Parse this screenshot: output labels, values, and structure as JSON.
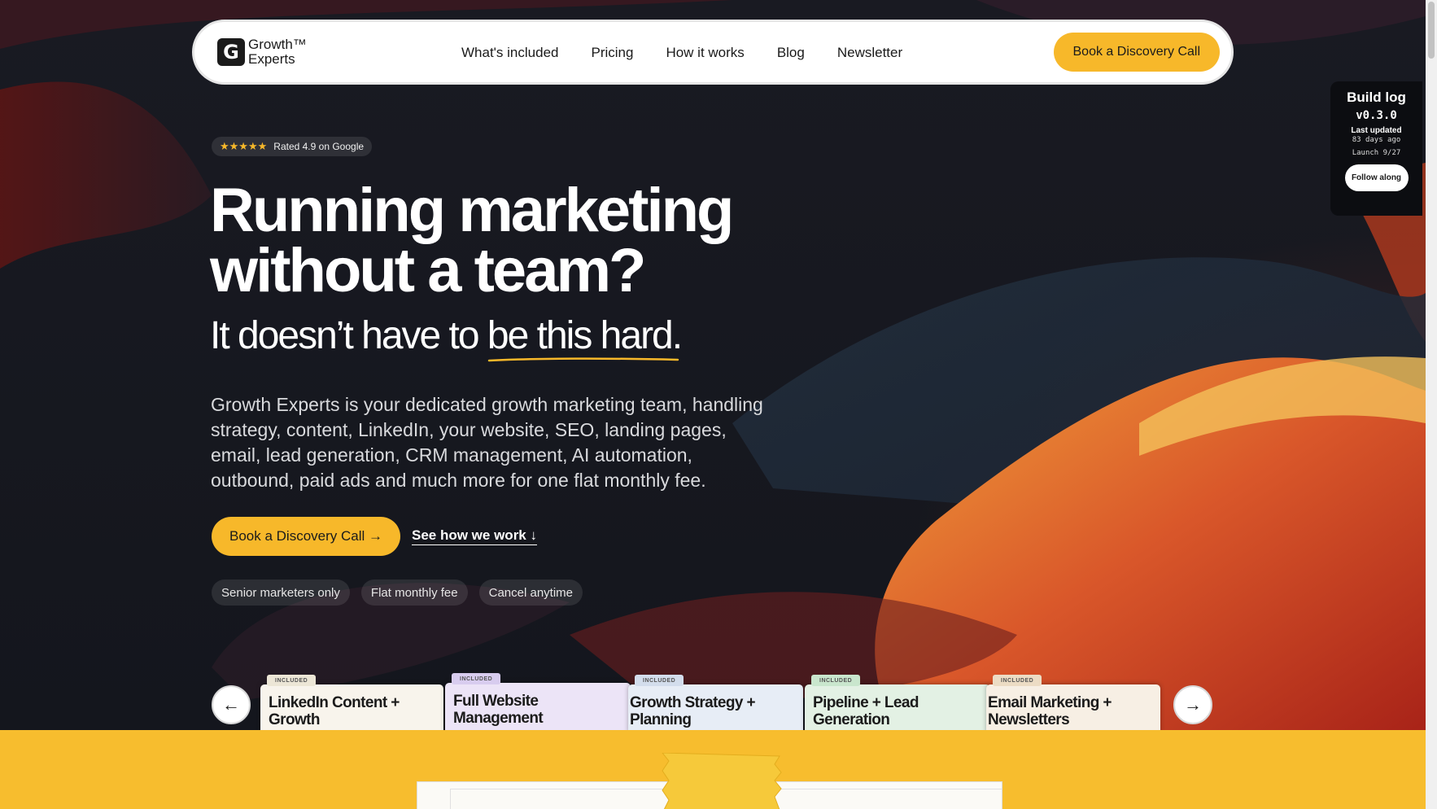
{
  "nav": {
    "logo_line1": "Growth™",
    "logo_line2": "Experts",
    "links": [
      "What's included",
      "Pricing",
      "How it works",
      "Blog",
      "Newsletter"
    ],
    "cta": "Book a Discovery Call"
  },
  "build_log": {
    "title": "Build log",
    "version": "v0.3.0",
    "updated_label": "Last updated",
    "updated_ago": "83 days ago",
    "launch": "Launch 9/27",
    "follow": "Follow along"
  },
  "hero": {
    "rating_stars": "★★★★★",
    "rating_text": "Rated 4.9 on Google",
    "headline": "Running marketing without a team?",
    "subhead_plain": "It doesn’t have to ",
    "subhead_underlined": "be this hard",
    "subhead_end": ".",
    "description": "Growth Experts is your dedicated growth marketing team, handling strategy, content, LinkedIn, your website, SEO, landing pages, email, lead generation, CRM management, AI automation, outbound, paid ads and much more for one flat monthly fee.",
    "cta_primary": "Book a Discovery Call →",
    "cta_secondary": "See how we work ↓",
    "chips": [
      "Senior marketers only",
      "Flat monthly fee",
      "Cancel anytime"
    ]
  },
  "carousel": {
    "prev_icon": "←",
    "next_icon": "→",
    "cards": [
      {
        "tag": "INCLUDED",
        "title_line1": "LinkedIn Content +",
        "title_line2": "Growth",
        "color": "#f8f4ec",
        "tag_color": "#ece6d6"
      },
      {
        "tag": "INCLUDED",
        "title_line1": "Full Website",
        "title_line2": "Management",
        "color": "#ece4f7",
        "tag_color": "#d8ccef"
      },
      {
        "tag": "INCLUDED",
        "title_line1": "Growth Strategy +",
        "title_line2": "Planning",
        "color": "#e7edf6",
        "tag_color": "#d3ddec"
      },
      {
        "tag": "INCLUDED",
        "title_line1": "Pipeline + Lead",
        "title_line2": "Generation",
        "color": "#e3f1e4",
        "tag_color": "#c9e6cd"
      },
      {
        "tag": "INCLUDED",
        "title_line1": "Email Marketing +",
        "title_line2": "Newsletters",
        "color": "#f7efe4",
        "tag_color": "#ecdcc4"
      }
    ]
  },
  "colors": {
    "accent": "#f7b82a",
    "hero_bg": "#14161d",
    "lower_bg": "#f7bd2e"
  }
}
